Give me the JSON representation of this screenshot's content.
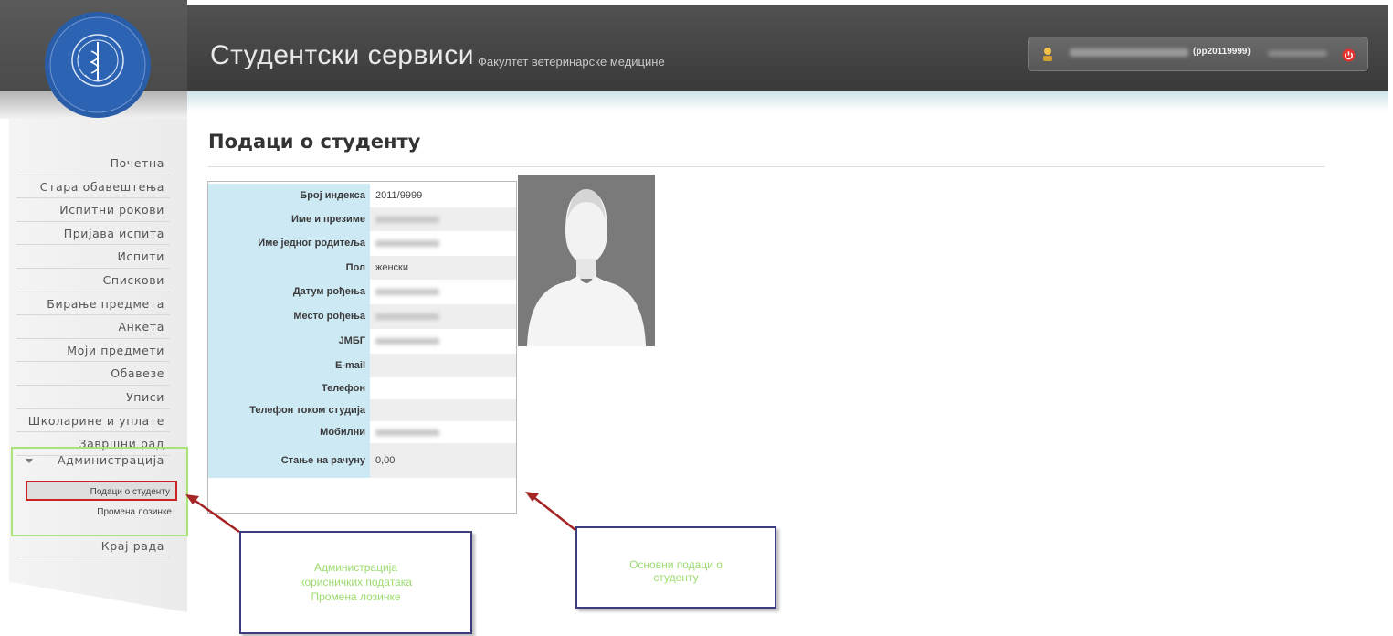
{
  "header": {
    "title": "Студентски сервиси",
    "subtitle": "Факултет ветеринарске медицине",
    "user_id": "(pp20119999)",
    "user_icon": "user-icon",
    "logout_icon": "power-icon"
  },
  "sidebar": {
    "logo": "faculty-seal-logo",
    "items": [
      {
        "label": "Почетна"
      },
      {
        "label": "Стара обавештења"
      },
      {
        "label": "Испитни рокови"
      },
      {
        "label": "Пријава испита"
      },
      {
        "label": "Испити"
      },
      {
        "label": "Спискови"
      },
      {
        "label": "Бирање предмета"
      },
      {
        "label": "Анкета"
      },
      {
        "label": "Моји предмети"
      },
      {
        "label": "Обавезе"
      },
      {
        "label": "Уписи"
      },
      {
        "label": "Школарине и уплате"
      },
      {
        "label": "Завршни рад"
      }
    ],
    "admin": {
      "label": "Администрација",
      "sub_items": [
        {
          "label": "Подаци о студенту",
          "active": true
        },
        {
          "label": "Промена лозинке",
          "active": false
        }
      ]
    },
    "end": "Крај рада"
  },
  "main": {
    "title": "Подаци о студенту",
    "fields": [
      {
        "label": "Број индекса",
        "value": "2011/9999",
        "blurred": false
      },
      {
        "label": "Име и презиме",
        "value": "",
        "blurred": true
      },
      {
        "label": "Име једног родитеља",
        "value": "",
        "blurred": true
      },
      {
        "label": "Пол",
        "value": "женски",
        "blurred": false
      },
      {
        "label": "Датум рођења",
        "value": "",
        "blurred": true
      },
      {
        "label": "Место рођења",
        "value": "",
        "blurred": true
      },
      {
        "label": "ЈМБГ",
        "value": "",
        "blurred": true
      },
      {
        "label": "E-mail",
        "value": "",
        "blurred": false
      },
      {
        "label": "Телефон",
        "value": "",
        "blurred": false
      },
      {
        "label": "Телефон током студија",
        "value": "",
        "blurred": false
      },
      {
        "label": "Мобилни",
        "value": "",
        "blurred": true
      },
      {
        "label": "Стање на рачуну",
        "value": "0,00",
        "blurred": false
      }
    ],
    "photo": "student-photo-placeholder"
  },
  "annotations": {
    "admin_note_lines": [
      "Администрација",
      "корисничких података",
      "Промена лозинке"
    ],
    "basic_note_lines": [
      "Основни подаци о",
      "студенту"
    ]
  },
  "colors": {
    "header_bg": "#474747",
    "label_bg": "#cde9f4",
    "highlight_red": "#cc2222",
    "highlight_green": "#a9e27a",
    "callout_border": "#3d3d7c",
    "callout_text": "#9bdc6e"
  }
}
